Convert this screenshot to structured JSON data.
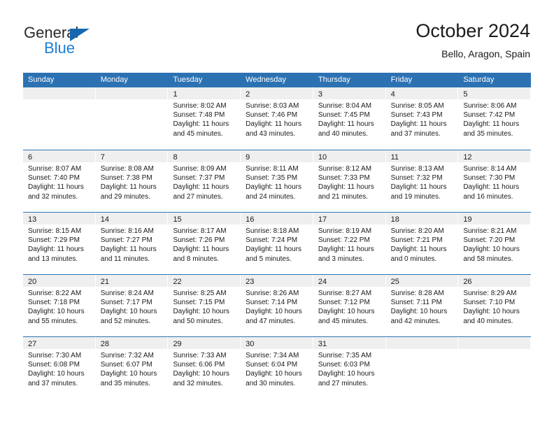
{
  "brand": {
    "name_part1": "General",
    "name_part2": "Blue",
    "triangle_color": "#1667b0",
    "blue_text_color": "#1b7fd4"
  },
  "header": {
    "title": "October 2024",
    "subtitle": "Bello, Aragon, Spain"
  },
  "colors": {
    "header_bar": "#2c72b3",
    "day_band": "#efefef",
    "text": "#1a1a1a",
    "row_separator": "#2c72b3"
  },
  "weekdays": [
    "Sunday",
    "Monday",
    "Tuesday",
    "Wednesday",
    "Thursday",
    "Friday",
    "Saturday"
  ],
  "labels": {
    "sunrise_prefix": "Sunrise:",
    "sunset_prefix": "Sunset:",
    "daylight_prefix": "Daylight:"
  },
  "weeks": [
    [
      {
        "day": "",
        "sunrise": "",
        "sunset": "",
        "daylight": ""
      },
      {
        "day": "",
        "sunrise": "",
        "sunset": "",
        "daylight": ""
      },
      {
        "day": "1",
        "sunrise": "Sunrise: 8:02 AM",
        "sunset": "Sunset: 7:48 PM",
        "daylight": "Daylight: 11 hours and 45 minutes."
      },
      {
        "day": "2",
        "sunrise": "Sunrise: 8:03 AM",
        "sunset": "Sunset: 7:46 PM",
        "daylight": "Daylight: 11 hours and 43 minutes."
      },
      {
        "day": "3",
        "sunrise": "Sunrise: 8:04 AM",
        "sunset": "Sunset: 7:45 PM",
        "daylight": "Daylight: 11 hours and 40 minutes."
      },
      {
        "day": "4",
        "sunrise": "Sunrise: 8:05 AM",
        "sunset": "Sunset: 7:43 PM",
        "daylight": "Daylight: 11 hours and 37 minutes."
      },
      {
        "day": "5",
        "sunrise": "Sunrise: 8:06 AM",
        "sunset": "Sunset: 7:42 PM",
        "daylight": "Daylight: 11 hours and 35 minutes."
      }
    ],
    [
      {
        "day": "6",
        "sunrise": "Sunrise: 8:07 AM",
        "sunset": "Sunset: 7:40 PM",
        "daylight": "Daylight: 11 hours and 32 minutes."
      },
      {
        "day": "7",
        "sunrise": "Sunrise: 8:08 AM",
        "sunset": "Sunset: 7:38 PM",
        "daylight": "Daylight: 11 hours and 29 minutes."
      },
      {
        "day": "8",
        "sunrise": "Sunrise: 8:09 AM",
        "sunset": "Sunset: 7:37 PM",
        "daylight": "Daylight: 11 hours and 27 minutes."
      },
      {
        "day": "9",
        "sunrise": "Sunrise: 8:11 AM",
        "sunset": "Sunset: 7:35 PM",
        "daylight": "Daylight: 11 hours and 24 minutes."
      },
      {
        "day": "10",
        "sunrise": "Sunrise: 8:12 AM",
        "sunset": "Sunset: 7:33 PM",
        "daylight": "Daylight: 11 hours and 21 minutes."
      },
      {
        "day": "11",
        "sunrise": "Sunrise: 8:13 AM",
        "sunset": "Sunset: 7:32 PM",
        "daylight": "Daylight: 11 hours and 19 minutes."
      },
      {
        "day": "12",
        "sunrise": "Sunrise: 8:14 AM",
        "sunset": "Sunset: 7:30 PM",
        "daylight": "Daylight: 11 hours and 16 minutes."
      }
    ],
    [
      {
        "day": "13",
        "sunrise": "Sunrise: 8:15 AM",
        "sunset": "Sunset: 7:29 PM",
        "daylight": "Daylight: 11 hours and 13 minutes."
      },
      {
        "day": "14",
        "sunrise": "Sunrise: 8:16 AM",
        "sunset": "Sunset: 7:27 PM",
        "daylight": "Daylight: 11 hours and 11 minutes."
      },
      {
        "day": "15",
        "sunrise": "Sunrise: 8:17 AM",
        "sunset": "Sunset: 7:26 PM",
        "daylight": "Daylight: 11 hours and 8 minutes."
      },
      {
        "day": "16",
        "sunrise": "Sunrise: 8:18 AM",
        "sunset": "Sunset: 7:24 PM",
        "daylight": "Daylight: 11 hours and 5 minutes."
      },
      {
        "day": "17",
        "sunrise": "Sunrise: 8:19 AM",
        "sunset": "Sunset: 7:22 PM",
        "daylight": "Daylight: 11 hours and 3 minutes."
      },
      {
        "day": "18",
        "sunrise": "Sunrise: 8:20 AM",
        "sunset": "Sunset: 7:21 PM",
        "daylight": "Daylight: 11 hours and 0 minutes."
      },
      {
        "day": "19",
        "sunrise": "Sunrise: 8:21 AM",
        "sunset": "Sunset: 7:20 PM",
        "daylight": "Daylight: 10 hours and 58 minutes."
      }
    ],
    [
      {
        "day": "20",
        "sunrise": "Sunrise: 8:22 AM",
        "sunset": "Sunset: 7:18 PM",
        "daylight": "Daylight: 10 hours and 55 minutes."
      },
      {
        "day": "21",
        "sunrise": "Sunrise: 8:24 AM",
        "sunset": "Sunset: 7:17 PM",
        "daylight": "Daylight: 10 hours and 52 minutes."
      },
      {
        "day": "22",
        "sunrise": "Sunrise: 8:25 AM",
        "sunset": "Sunset: 7:15 PM",
        "daylight": "Daylight: 10 hours and 50 minutes."
      },
      {
        "day": "23",
        "sunrise": "Sunrise: 8:26 AM",
        "sunset": "Sunset: 7:14 PM",
        "daylight": "Daylight: 10 hours and 47 minutes."
      },
      {
        "day": "24",
        "sunrise": "Sunrise: 8:27 AM",
        "sunset": "Sunset: 7:12 PM",
        "daylight": "Daylight: 10 hours and 45 minutes."
      },
      {
        "day": "25",
        "sunrise": "Sunrise: 8:28 AM",
        "sunset": "Sunset: 7:11 PM",
        "daylight": "Daylight: 10 hours and 42 minutes."
      },
      {
        "day": "26",
        "sunrise": "Sunrise: 8:29 AM",
        "sunset": "Sunset: 7:10 PM",
        "daylight": "Daylight: 10 hours and 40 minutes."
      }
    ],
    [
      {
        "day": "27",
        "sunrise": "Sunrise: 7:30 AM",
        "sunset": "Sunset: 6:08 PM",
        "daylight": "Daylight: 10 hours and 37 minutes."
      },
      {
        "day": "28",
        "sunrise": "Sunrise: 7:32 AM",
        "sunset": "Sunset: 6:07 PM",
        "daylight": "Daylight: 10 hours and 35 minutes."
      },
      {
        "day": "29",
        "sunrise": "Sunrise: 7:33 AM",
        "sunset": "Sunset: 6:06 PM",
        "daylight": "Daylight: 10 hours and 32 minutes."
      },
      {
        "day": "30",
        "sunrise": "Sunrise: 7:34 AM",
        "sunset": "Sunset: 6:04 PM",
        "daylight": "Daylight: 10 hours and 30 minutes."
      },
      {
        "day": "31",
        "sunrise": "Sunrise: 7:35 AM",
        "sunset": "Sunset: 6:03 PM",
        "daylight": "Daylight: 10 hours and 27 minutes."
      },
      {
        "day": "",
        "sunrise": "",
        "sunset": "",
        "daylight": ""
      },
      {
        "day": "",
        "sunrise": "",
        "sunset": "",
        "daylight": ""
      }
    ]
  ]
}
